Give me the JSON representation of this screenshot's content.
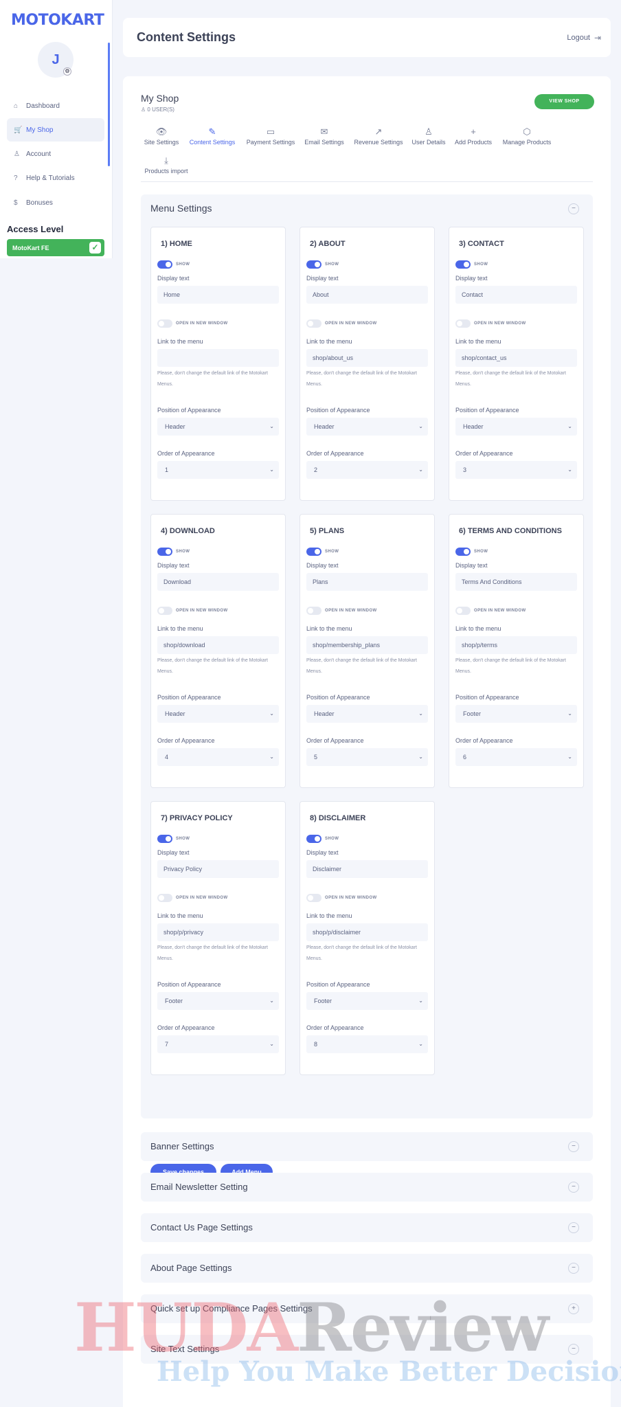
{
  "app": {
    "logo": "MOTOKART"
  },
  "user": {
    "initial": "J"
  },
  "sidebar": {
    "items": [
      {
        "label": "Dashboard",
        "icon": "home-icon"
      },
      {
        "label": "My Shop",
        "icon": "cart-icon"
      },
      {
        "label": "Account",
        "icon": "user-icon"
      },
      {
        "label": "Help & Tutorials",
        "icon": "question-icon"
      },
      {
        "label": "Bonuses",
        "icon": "dollar-icon"
      }
    ],
    "active": "My Shop",
    "access_level_title": "Access Level",
    "access_level": "MotoKart FE"
  },
  "header": {
    "title": "Content Settings",
    "logout": "Logout"
  },
  "shop": {
    "name": "My Shop",
    "users": "0 USER(S)",
    "view_shop": "VIEW SHOP"
  },
  "tabs": [
    {
      "label": "Site Settings",
      "icon": "eye-icon"
    },
    {
      "label": "Content Settings",
      "icon": "pencil-icon",
      "active": true
    },
    {
      "label": "Payment Settings",
      "icon": "card-icon"
    },
    {
      "label": "Email Settings",
      "icon": "mail-icon"
    },
    {
      "label": "Revenue Settings",
      "icon": "chart-icon"
    },
    {
      "label": "User Details",
      "icon": "user-icon"
    },
    {
      "label": "Add Products",
      "icon": "plus-icon"
    },
    {
      "label": "Manage Products",
      "icon": "box-icon"
    },
    {
      "label": "Products import",
      "icon": "download-icon"
    }
  ],
  "menu_settings": {
    "title": "Menu Settings",
    "show_label": "SHOW",
    "new_window_label": "OPEN IN NEW WINDOW",
    "display_text_label": "Display text",
    "link_label": "Link to the menu",
    "hint": "Please, don't change the default link of the Motokart Menus.",
    "position_label": "Position of Appearance",
    "order_label": "Order of Appearance",
    "menus": [
      {
        "title": "1) HOME",
        "display": "Home",
        "link": "",
        "position": "Header",
        "order": "1"
      },
      {
        "title": "2) ABOUT",
        "display": "About",
        "link": "shop/about_us",
        "position": "Header",
        "order": "2"
      },
      {
        "title": "3) CONTACT",
        "display": "Contact",
        "link": "shop/contact_us",
        "position": "Header",
        "order": "3"
      },
      {
        "title": "4) DOWNLOAD",
        "display": "Download",
        "link": "shop/download",
        "position": "Header",
        "order": "4"
      },
      {
        "title": "5) PLANS",
        "display": "Plans",
        "link": "shop/membership_plans",
        "position": "Header",
        "order": "5"
      },
      {
        "title": "6) TERMS AND CONDITIONS",
        "display": "Terms And Conditions",
        "link": "shop/p/terms",
        "position": "Footer",
        "order": "6"
      },
      {
        "title": "7) PRIVACY POLICY",
        "display": "Privacy Policy",
        "link": "shop/p/privacy",
        "position": "Footer",
        "order": "7"
      },
      {
        "title": "8) DISCLAIMER",
        "display": "Disclaimer",
        "link": "shop/p/disclaimer",
        "position": "Footer",
        "order": "8"
      }
    ],
    "save": "Save changes",
    "add": "Add Menu"
  },
  "sections": [
    {
      "title": "Banner Settings",
      "symbol": "−"
    },
    {
      "title": "Email Newsletter Setting",
      "symbol": "−"
    },
    {
      "title": "Contact Us Page Settings",
      "symbol": "−"
    },
    {
      "title": "About Page Settings",
      "symbol": "−"
    },
    {
      "title": "Quick set up Compliance Pages Settings",
      "symbol": "+"
    },
    {
      "title": "Site Text Settings",
      "symbol": "−"
    }
  ],
  "watermark": {
    "brand_a": "HUDA",
    "brand_b": "Review",
    "tagline": "Help You Make Better Decisions"
  },
  "colors": {
    "accent": "#4a66e8",
    "success": "#43b35a",
    "background": "#f3f5fb"
  }
}
